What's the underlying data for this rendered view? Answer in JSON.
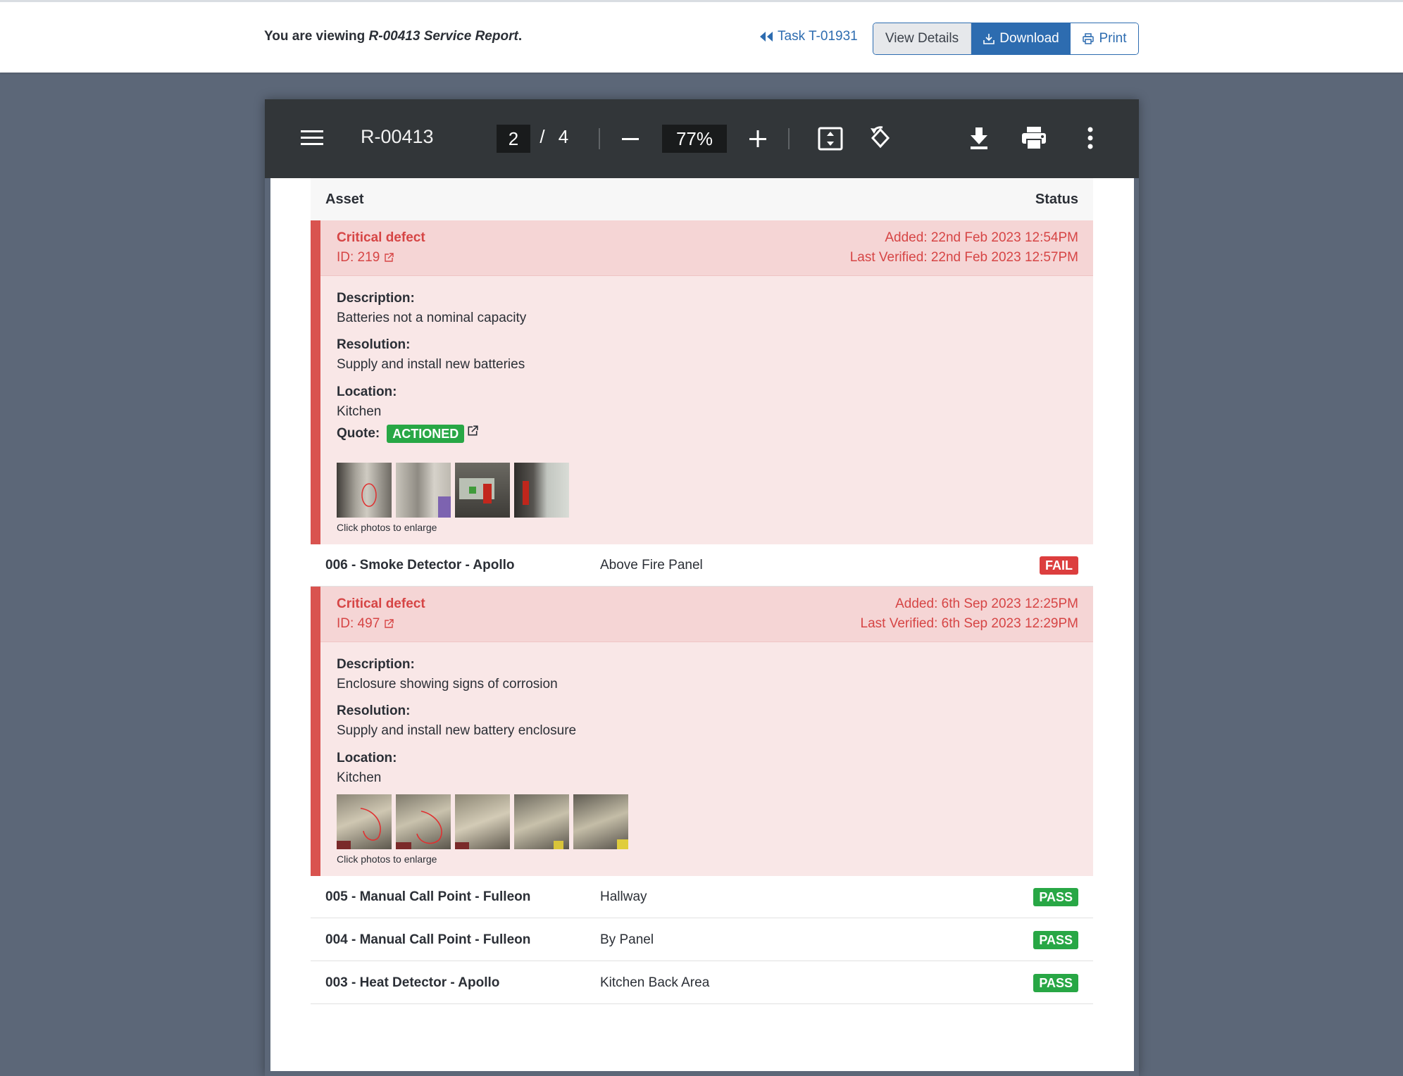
{
  "header": {
    "viewing_prefix": "You are viewing",
    "viewing_doc": "R-00413 Service Report",
    "viewing_suffix": ".",
    "task_link": "Task T-01931",
    "view_details": "View Details",
    "download": "Download",
    "print": "Print"
  },
  "viewer": {
    "title": "R-00413",
    "page_current": "2",
    "page_separator": "/",
    "page_total": "4",
    "zoom": "77%"
  },
  "table": {
    "col_asset": "Asset",
    "col_status": "Status"
  },
  "defects": [
    {
      "title": "Critical defect",
      "id": "ID: 219",
      "added": "Added: 22nd Feb 2023 12:54PM",
      "verified": "Last Verified: 22nd Feb 2023 12:57PM",
      "description_label": "Description:",
      "description": "Batteries not a nominal capacity",
      "resolution_label": "Resolution:",
      "resolution": "Supply and install new batteries",
      "location_label": "Location:",
      "location": "Kitchen",
      "quote_label": "Quote:",
      "quote_status": "ACTIONED",
      "photo_caption": "Click photos to enlarge"
    },
    {
      "title": "Critical defect",
      "id": "ID: 497",
      "added": "Added: 6th Sep 2023 12:25PM",
      "verified": "Last Verified: 6th Sep 2023 12:29PM",
      "description_label": "Description:",
      "description": "Enclosure showing signs of corrosion",
      "resolution_label": "Resolution:",
      "resolution": "Supply and install new battery enclosure",
      "location_label": "Location:",
      "location": "Kitchen",
      "photo_caption": "Click photos to enlarge"
    }
  ],
  "assets": [
    {
      "name": "006 - Smoke Detector - Apollo",
      "location": "Above Fire Panel",
      "status": "FAIL"
    },
    {
      "name": "005 - Manual Call Point - Fulleon",
      "location": "Hallway",
      "status": "PASS"
    },
    {
      "name": "004 - Manual Call Point - Fulleon",
      "location": "By Panel",
      "status": "PASS"
    },
    {
      "name": "003 - Heat Detector - Apollo",
      "location": "Kitchen Back Area",
      "status": "PASS"
    }
  ],
  "colors": {
    "primary": "#2d6cb0",
    "danger": "#d9534f",
    "success": "#28a745",
    "toolbar": "#323639",
    "backdrop": "#5c6778"
  }
}
